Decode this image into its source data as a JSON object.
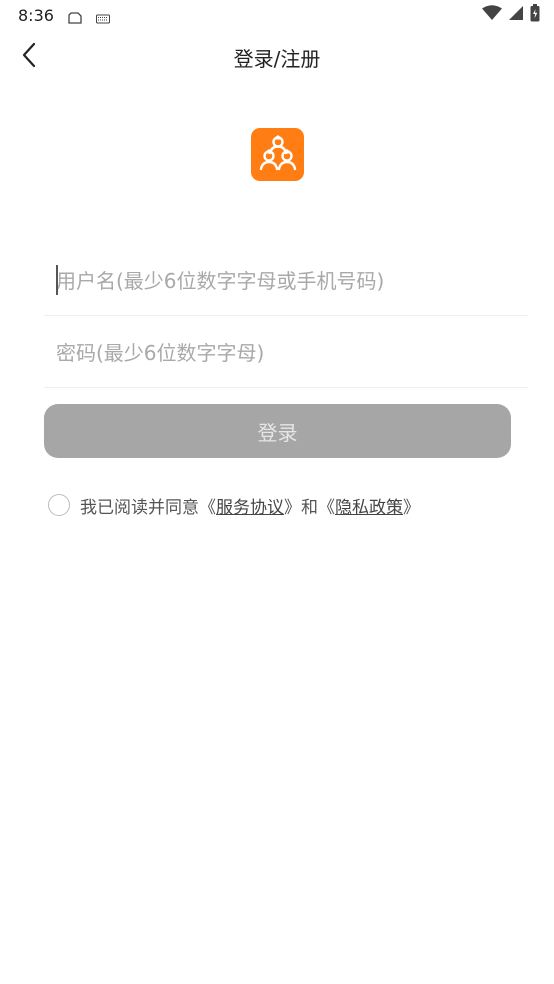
{
  "status_bar": {
    "time": "8:36",
    "icons": [
      "document-icon",
      "keyboard-icon",
      "wifi-icon",
      "signal-icon",
      "battery-icon"
    ]
  },
  "header": {
    "title": "登录/注册",
    "back_icon": "chevron-left-icon"
  },
  "logo": {
    "icon": "people-hierarchy-icon",
    "color": "#ff7d12"
  },
  "form": {
    "username": {
      "value": "",
      "placeholder": "用户名(最少6位数字字母或手机号码)"
    },
    "password": {
      "value": "",
      "placeholder": "密码(最少6位数字字母)"
    },
    "login_label": "登录",
    "login_button_color": "#a6a6a6"
  },
  "agreement": {
    "checked": false,
    "prefix": "我已阅读并同意《",
    "service_link": "服务协议",
    "middle": "》和《",
    "privacy_link": "隐私政策",
    "suffix": "》"
  }
}
